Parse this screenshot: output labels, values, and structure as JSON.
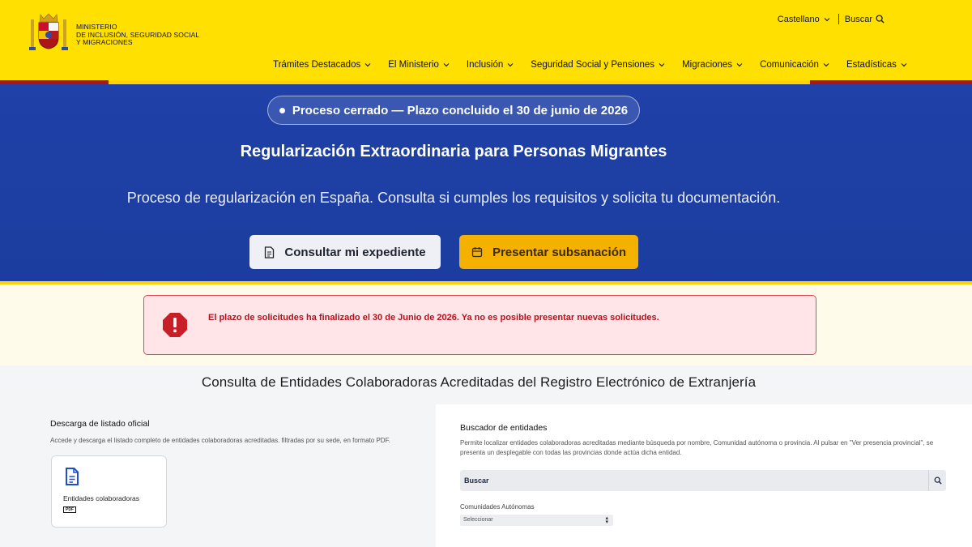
{
  "header": {
    "ministry_lines": [
      "Ministerio",
      "de Inclusión, Seguridad Social",
      "y Migraciones"
    ],
    "language": "Castellano",
    "search_label": "Buscar",
    "nav": [
      {
        "label": "Trámites Destacados"
      },
      {
        "label": "El Ministerio"
      },
      {
        "label": "Inclusión"
      },
      {
        "label": "Seguridad Social y Pensiones"
      },
      {
        "label": "Migraciones"
      },
      {
        "label": "Comunicación"
      },
      {
        "label": "Estadísticas"
      }
    ]
  },
  "hero": {
    "status_pill": "Proceso cerrado — Plazo concluido el 30 de junio de 2026",
    "title": "Regularización Extraordinaria para Personas Migrantes",
    "subtitle": "Proceso de regularización en España. Consulta si cumples los requisitos y solicita tu documentación.",
    "primary_button": "Consultar mi expediente",
    "secondary_button": "Presentar subsanación"
  },
  "alert": {
    "message": "El plazo de solicitudes ha finalizado el 30 de Junio de 2026. Ya no es posible presentar nuevas solicitudes."
  },
  "section": {
    "title": "Consulta de Entidades Colaboradoras Acreditadas del Registro Electrónico de Extranjería",
    "download": {
      "heading": "Descarga de listado oficial",
      "description": "Accede y descarga el listado completo de entidades colaboradoras acreditadas. filtradas por su sede, en formato PDF.",
      "card_label": "Entidades colaboradoras",
      "card_badge": "PDF"
    },
    "finder": {
      "heading": "Buscador de entidades",
      "description": "Permite localizar entidades colaboradoras acreditadas mediante búsqueda por nombre, Comunidad autónoma o provincia. Al pulsar en \"Ver presencia provincial\", se presenta un desplegable con todas las provincias donde actúa dicha entidad.",
      "search_placeholder": "Buscar",
      "region_label": "Comunidades Autónomas",
      "region_value": "Seleccionar"
    }
  },
  "colors": {
    "header_yellow": "#ffe000",
    "hero_blue": "#1f41a8",
    "accent_amber": "#f4b100",
    "alert_red": "#e24650",
    "flag_red": "#ad1519"
  },
  "icons": [
    "coat-of-arms-logo",
    "chevron-down-icon",
    "search-icon",
    "file-text-icon",
    "calendar-icon",
    "alert-octagon-icon",
    "document-icon",
    "sort-arrows-icon"
  ]
}
